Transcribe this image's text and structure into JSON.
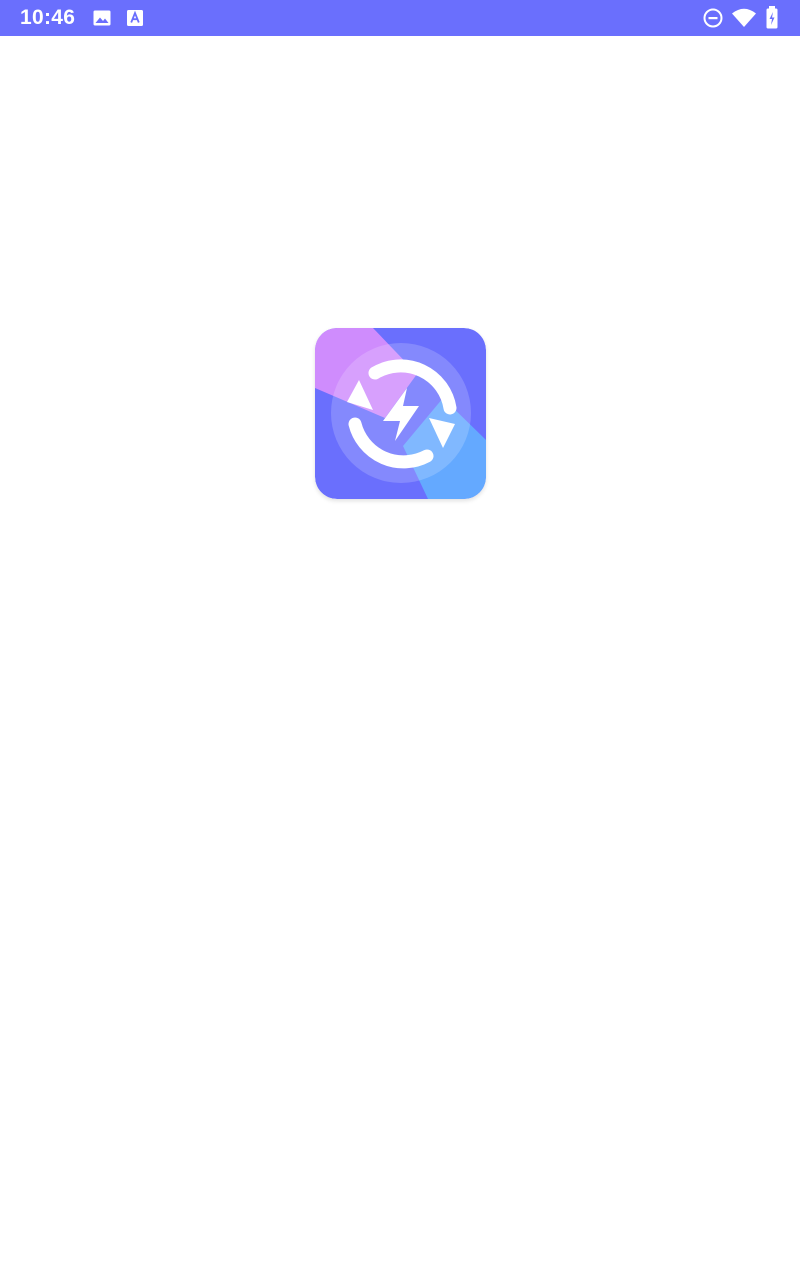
{
  "status_bar": {
    "time": "10:46",
    "background_color": "#6a6ffd",
    "left_icons": [
      "image-icon",
      "text-a-icon"
    ],
    "right_icons": [
      "do-not-disturb-icon",
      "wifi-icon",
      "battery-charging-icon"
    ]
  },
  "splash": {
    "logo_icon": "recycle-lightning-logo-icon",
    "colors": {
      "purple": "#cf8cfd",
      "indigo": "#6a6ffd",
      "blue": "#64a9ff"
    }
  }
}
